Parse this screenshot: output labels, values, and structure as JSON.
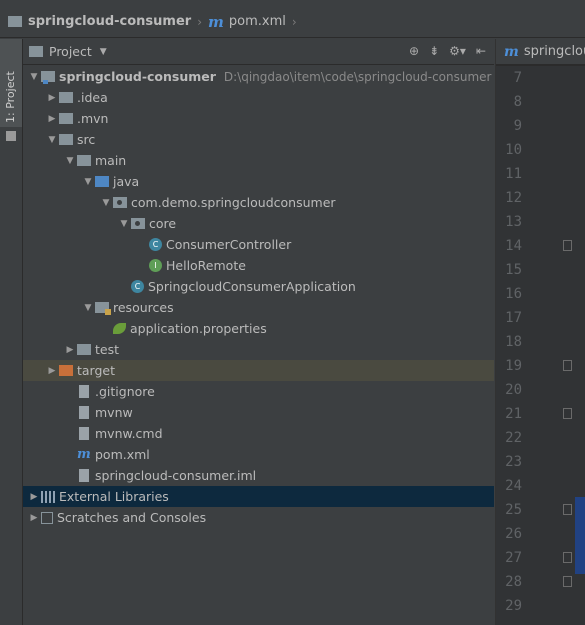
{
  "breadcrumb": {
    "project": "springcloud-consumer",
    "file": "pom.xml"
  },
  "side_tab": {
    "label": "1: Project"
  },
  "project_panel": {
    "title": "Project",
    "tools": [
      "globe-icon",
      "collapse-icon",
      "gear-icon",
      "hide-icon"
    ]
  },
  "tree": [
    {
      "label": "springcloud-consumer",
      "path": "D:\\qingdao\\item\\code\\springcloud-consumer",
      "depth": 0,
      "arrow": "down",
      "icon": "module-folder-icon",
      "bold": true
    },
    {
      "label": ".idea",
      "depth": 1,
      "arrow": "right",
      "icon": "folder-icon"
    },
    {
      "label": ".mvn",
      "depth": 1,
      "arrow": "right",
      "icon": "folder-icon"
    },
    {
      "label": "src",
      "depth": 1,
      "arrow": "down",
      "icon": "folder-icon"
    },
    {
      "label": "main",
      "depth": 2,
      "arrow": "down",
      "icon": "folder-icon"
    },
    {
      "label": "java",
      "depth": 3,
      "arrow": "down",
      "icon": "source-folder-icon"
    },
    {
      "label": "com.demo.springcloudconsumer",
      "depth": 4,
      "arrow": "down",
      "icon": "package-icon"
    },
    {
      "label": "core",
      "depth": 5,
      "arrow": "down",
      "icon": "package-icon"
    },
    {
      "label": "ConsumerController",
      "depth": 6,
      "arrow": "",
      "icon": "class-icon"
    },
    {
      "label": "HelloRemote",
      "depth": 6,
      "arrow": "",
      "icon": "interface-icon"
    },
    {
      "label": "SpringcloudConsumerApplication",
      "depth": 5,
      "arrow": "",
      "icon": "spring-app-icon"
    },
    {
      "label": "resources",
      "depth": 3,
      "arrow": "down",
      "icon": "resources-folder-icon"
    },
    {
      "label": "application.properties",
      "depth": 4,
      "arrow": "",
      "icon": "spring-leaf-icon"
    },
    {
      "label": "test",
      "depth": 2,
      "arrow": "right",
      "icon": "folder-icon"
    },
    {
      "label": "target",
      "depth": 1,
      "arrow": "right",
      "icon": "excluded-folder-icon",
      "highlight": "target"
    },
    {
      "label": ".gitignore",
      "depth": 2,
      "arrow": "",
      "icon": "file-icon"
    },
    {
      "label": "mvnw",
      "depth": 2,
      "arrow": "",
      "icon": "file-icon"
    },
    {
      "label": "mvnw.cmd",
      "depth": 2,
      "arrow": "",
      "icon": "file-icon"
    },
    {
      "label": "pom.xml",
      "depth": 2,
      "arrow": "",
      "icon": "maven-icon"
    },
    {
      "label": "springcloud-consumer.iml",
      "depth": 2,
      "arrow": "",
      "icon": "file-icon"
    },
    {
      "label": "External Libraries",
      "depth": 0,
      "arrow": "right",
      "icon": "libraries-icon",
      "highlight": "ext"
    },
    {
      "label": "Scratches and Consoles",
      "depth": 0,
      "arrow": "right",
      "icon": "scratches-icon"
    }
  ],
  "editor": {
    "tab_label": "springclou",
    "line_numbers": [
      "7",
      "8",
      "9",
      "10",
      "11",
      "12",
      "13",
      "14",
      "15",
      "16",
      "17",
      "18",
      "19",
      "20",
      "21",
      "22",
      "23",
      "24",
      "25",
      "26",
      "27",
      "28",
      "29"
    ],
    "fold_lines": [
      "14",
      "19",
      "21",
      "25",
      "27",
      "28"
    ]
  },
  "colors": {
    "background": "#3c3f41",
    "target_highlight": "#4a4a40",
    "selection": "#0d293e",
    "accent_blue": "#4d8fd8"
  }
}
